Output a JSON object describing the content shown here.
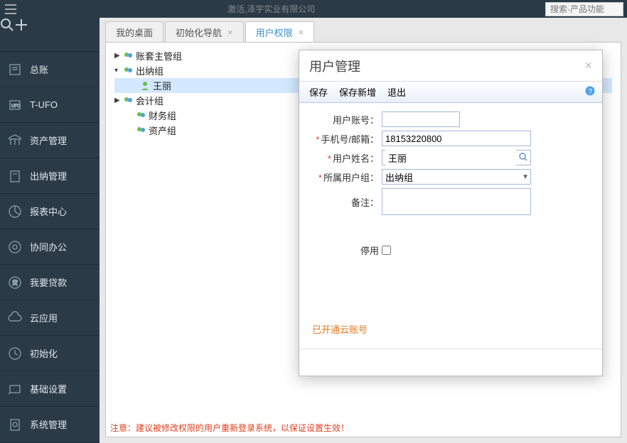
{
  "topbar": {
    "title": "激活,泽宇实业有限公司",
    "search_placeholder": "搜索-产品功能"
  },
  "sidebar": {
    "items": [
      {
        "label": "总账"
      },
      {
        "label": "T-UFO"
      },
      {
        "label": "资产管理"
      },
      {
        "label": "出纳管理"
      },
      {
        "label": "报表中心"
      },
      {
        "label": "协同办公"
      },
      {
        "label": "我要贷款"
      },
      {
        "label": "云应用"
      },
      {
        "label": "初始化"
      },
      {
        "label": "基础设置"
      },
      {
        "label": "系统管理"
      }
    ]
  },
  "tabs": [
    {
      "label": "我的桌面",
      "closable": false
    },
    {
      "label": "初始化导航",
      "closable": true
    },
    {
      "label": "用户权限",
      "closable": true,
      "active": true
    }
  ],
  "tree": {
    "nodes": [
      {
        "label": "账套主管组",
        "level": 0,
        "toggle": "▶"
      },
      {
        "label": "出纳组",
        "level": 0,
        "toggle": "▾"
      },
      {
        "label": "王丽",
        "level": 1,
        "user": true,
        "selected": true
      },
      {
        "label": "会计组",
        "level": 0,
        "toggle": "▶"
      },
      {
        "label": "财务组",
        "level": 1
      },
      {
        "label": "资产组",
        "level": 1
      }
    ]
  },
  "footer": {
    "note": "注意：建议被修改权限的用户重新登录系统，以保证设置生效！"
  },
  "dialog": {
    "title": "用户管理",
    "toolbar": {
      "save": "保存",
      "save_add": "保存新增",
      "exit": "退出"
    },
    "form": {
      "account_label": "用户账号：",
      "account_value": "",
      "phone_label": "手机号/邮箱：",
      "phone_value": "18153220800",
      "name_label": "用户姓名：",
      "name_value": "王丽",
      "group_label": "所属用户组：",
      "group_value": "出纳组",
      "remark_label": "备注：",
      "remark_value": "",
      "disable_label": "停用"
    },
    "cloud_note": "已开通云账号"
  }
}
